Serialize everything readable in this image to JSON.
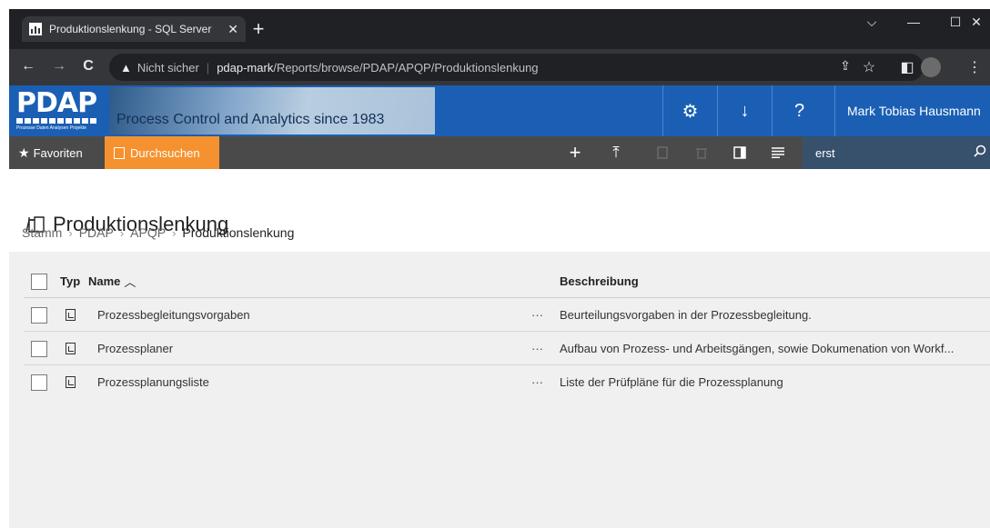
{
  "browser": {
    "tab_title": "Produktionslenkung - SQL Server",
    "tab_close": "✕",
    "new_tab": "+",
    "window_controls": {
      "menu": "⌵",
      "minimize": "—",
      "maximize": "☐",
      "close": "✕"
    },
    "back": "←",
    "forward": "→",
    "reload": "C",
    "security_label": "Nicht sicher",
    "url_host": "pdap-mark",
    "url_path": "/Reports/browse/PDAP/APQP/Produktionslenkung",
    "share_icon": "⇪",
    "bookmark_icon": "☆",
    "sidepanel_icon": "◧",
    "menu_icon": "⋮"
  },
  "banner": {
    "logo": "PDAP",
    "logo_sub": "Prozesse Daten Analysen Projekte",
    "tagline": "Process Control and Analytics since 1983",
    "settings_icon": "⚙",
    "download_icon": "↓",
    "help_icon": "?",
    "user_name": "Mark Tobias Hausmann"
  },
  "commandbar": {
    "favorites": "Favoriten",
    "browse": "Durchsuchen",
    "new_icon": "+",
    "upload_icon": "⤒",
    "search_value": "erst"
  },
  "page": {
    "title": "Produktionslenkung",
    "breadcrumb": [
      "Stamm",
      "PDAP",
      "APQP",
      "Produktionslenkung"
    ],
    "breadcrumb_sep": "›"
  },
  "table": {
    "headers": {
      "type": "Typ",
      "name": "Name",
      "sort_indicator": "︿",
      "description": "Beschreibung"
    },
    "rows": [
      {
        "name": "Prozessbegleitungsvorgaben",
        "menu": "···",
        "description": "Beurteilungsvorgaben in der Prozessbegleitung."
      },
      {
        "name": "Prozessplaner",
        "menu": "···",
        "description": "Aufbau von Prozess- und Arbeitsgängen, sowie Dokumenation von Workf..."
      },
      {
        "name": "Prozessplanungsliste",
        "menu": "···",
        "description": "Liste der Prüfpläne für die Prozessplanung"
      }
    ]
  }
}
